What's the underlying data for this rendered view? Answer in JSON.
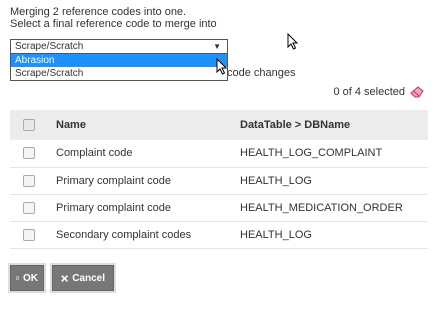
{
  "intro": {
    "line1": "Merging 2 reference codes into one.",
    "line2": "Select a final reference code to merge into"
  },
  "select": {
    "value": "Scrape/Scratch",
    "options": [
      "Abrasion",
      "Scrape/Scratch"
    ],
    "highlighted": "Abrasion"
  },
  "note_suffix": "code changes",
  "selection": {
    "count_text": "0 of 4 selected"
  },
  "table": {
    "headers": [
      "Name",
      "DataTable > DBName"
    ],
    "rows": [
      {
        "name": "Complaint code",
        "db": "HEALTH_LOG_COMPLAINT"
      },
      {
        "name": "Primary complaint code",
        "db": "HEALTH_LOG"
      },
      {
        "name": "Primary complaint code",
        "db": "HEALTH_MEDICATION_ORDER"
      },
      {
        "name": "Secondary complaint codes",
        "db": "HEALTH_LOG"
      }
    ]
  },
  "buttons": {
    "ok": "OK",
    "cancel": "Cancel"
  },
  "colors": {
    "highlight": "#1e90ff",
    "button": "#777777",
    "eraser": "#e0507a"
  }
}
